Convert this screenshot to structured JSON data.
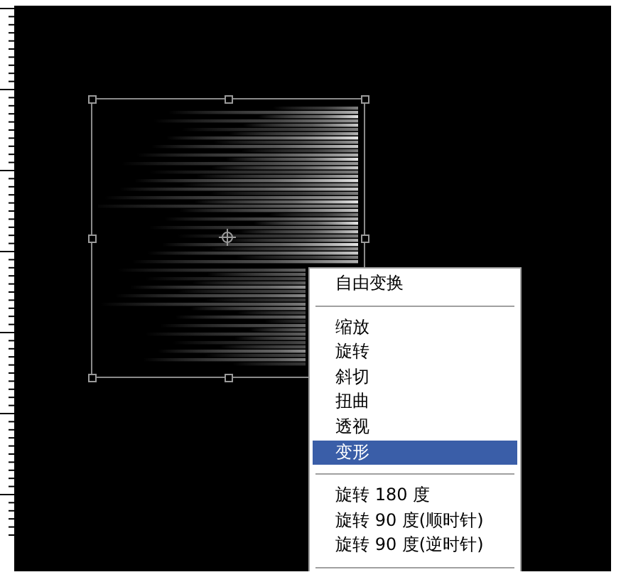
{
  "context_menu": {
    "items": [
      {
        "kind": "item",
        "label": "自由变换",
        "selected": false
      },
      {
        "kind": "separator"
      },
      {
        "kind": "item",
        "label": "缩放",
        "selected": false
      },
      {
        "kind": "item",
        "label": "旋转",
        "selected": false
      },
      {
        "kind": "item",
        "label": "斜切",
        "selected": false
      },
      {
        "kind": "item",
        "label": "扭曲",
        "selected": false
      },
      {
        "kind": "item",
        "label": "透视",
        "selected": false
      },
      {
        "kind": "item",
        "label": "变形",
        "selected": true
      },
      {
        "kind": "separator"
      },
      {
        "kind": "item",
        "label": "旋转 180 度",
        "selected": false
      },
      {
        "kind": "item",
        "label": "旋转 90 度(顺时针)",
        "selected": false
      },
      {
        "kind": "item",
        "label": "旋转 90 度(逆时针)",
        "selected": false
      },
      {
        "kind": "separator"
      }
    ]
  }
}
